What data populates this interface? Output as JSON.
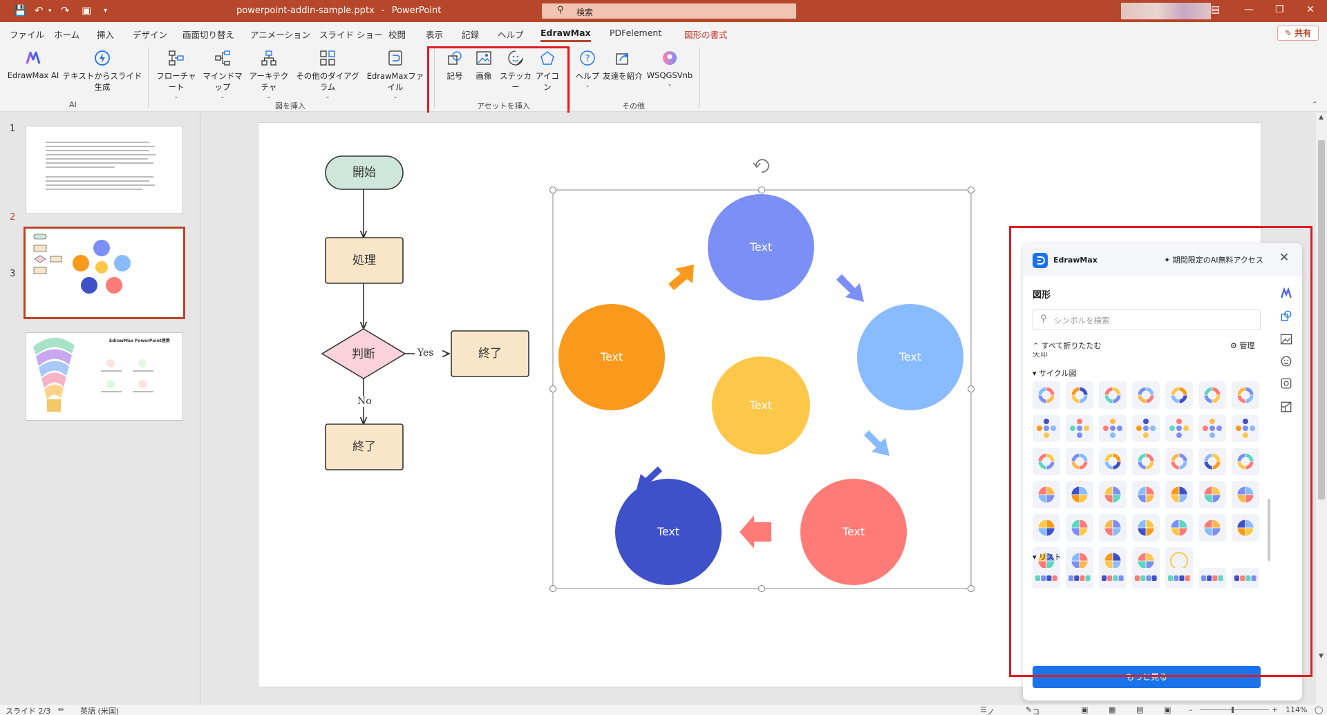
{
  "titlebar": {
    "file_name": "powerpoint-addin-sample.pptx",
    "separator": "-",
    "app_name": "PowerPoint",
    "search_placeholder": "検索"
  },
  "tabs": [
    "ファイル",
    "ホーム",
    "挿入",
    "デザイン",
    "画面切り替え",
    "アニメーション",
    "スライド ショー",
    "校閲",
    "表示",
    "記録",
    "ヘルプ",
    "EdrawMax",
    "PDFelement",
    "図形の書式"
  ],
  "active_tab": "EdrawMax",
  "share_label": "共有",
  "ribbon": {
    "ai_group": {
      "label": "AI",
      "items": [
        "EdrawMax AI",
        "テキストからスライド生成"
      ]
    },
    "insert_group": {
      "label": "図を挿入",
      "items": [
        "フローチャート",
        "マインドマップ",
        "アーキテクチャ",
        "その他のダイアグラム",
        "EdrawMaxファイル"
      ]
    },
    "asset_group": {
      "label": "アセットを挿入",
      "items": [
        "記号",
        "画像",
        "ステッカー",
        "アイコン"
      ]
    },
    "other_group": {
      "label": "その他",
      "items": [
        "ヘルプ",
        "友達を紹介",
        "WSQGSVnb"
      ]
    }
  },
  "slides": {
    "numbers": [
      "1",
      "2",
      "3"
    ],
    "selected": 2,
    "thumb3_title": "EdrawMax PowerPoint連携"
  },
  "flowchart": {
    "start": "開始",
    "process": "処理",
    "decision": "判断",
    "end_right": "終了",
    "end_bottom": "終了",
    "yes": "Yes",
    "no": "No"
  },
  "cycle": {
    "top": "Text",
    "left": "Text",
    "right": "Text",
    "center": "Text",
    "bottom_left": "Text",
    "bottom_right": "Text",
    "colors": {
      "top": "#7b8ff7",
      "left": "#f99a1c",
      "right": "#89bbff",
      "center": "#fdc84a",
      "bottom_left": "#3f51c8",
      "bottom_right": "#ff7b77"
    }
  },
  "edraw_panel": {
    "brand": "EdrawMax",
    "promo": "期間限定のAI無料アクセス",
    "section_title": "図形",
    "search_placeholder": "シンボルを検索",
    "collapse_all": "すべて折りたたむ",
    "manage": "管理",
    "partial_category": "矢印",
    "cycle_category": "サイクル図",
    "list_category": "リスト",
    "more_button": "もっと見る"
  },
  "statusbar": {
    "slide_info": "スライド 2/3",
    "language": "英語 (米国)",
    "notes": "ノート",
    "comments": "コメント",
    "zoom": "114%"
  }
}
